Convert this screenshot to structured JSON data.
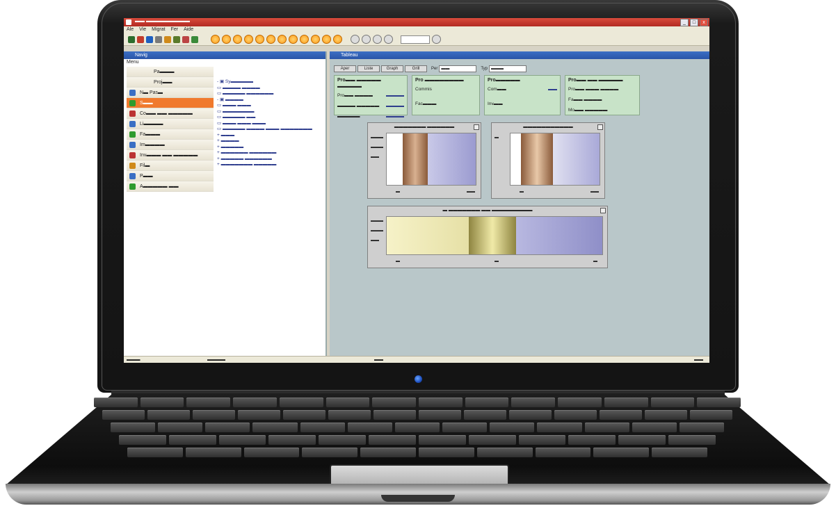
{
  "window": {
    "title": "▬▬ ▬▬▬▬▬▬▬▬▬",
    "controls": [
      "_",
      "□",
      "x"
    ]
  },
  "menu": [
    "Ale",
    "Vie",
    "Migrat",
    "Fer",
    "Aide"
  ],
  "toolbar": {
    "icon_colors": [
      "#2d6d2d",
      "#c23b2b",
      "#1f5fbf",
      "#7a7a7a",
      "#d08a1a",
      "#5a7a2a",
      "#b44",
      "#3a8a3a"
    ],
    "orange_buttons": 12,
    "gray_buttons": 4
  },
  "left_panel": {
    "title": "Navig",
    "section": "Menu",
    "nav_items": [
      {
        "label": "Pa▬▬▬",
        "icon": "none",
        "color": ""
      },
      {
        "label": "Proj▬▬",
        "icon": "none",
        "color": ""
      },
      {
        "label": "N▬ Pas▬",
        "icon": "user-icon",
        "color": "#3a6fc4"
      },
      {
        "label": "S▬▬",
        "icon": "folder-icon",
        "color": "#2e9b2e",
        "selected": true
      },
      {
        "label": "Co▬▬ ▬▬ ▬▬▬▬▬",
        "icon": "doc-icon",
        "color": "#b33"
      },
      {
        "label": "Li▬▬▬▬",
        "icon": "doc-icon",
        "color": "#3a6fc4"
      },
      {
        "label": "Fa▬▬▬",
        "icon": "doc-icon",
        "color": "#2e9b2e"
      },
      {
        "label": "Im▬▬▬▬",
        "icon": "doc-icon",
        "color": "#3a6fc4"
      },
      {
        "label": "Inv▬▬▬ ▬▬ ▬▬▬▬▬",
        "icon": "doc-icon",
        "color": "#b33"
      },
      {
        "label": "Fil▬",
        "icon": "doc-icon",
        "color": "#d08a1a"
      },
      {
        "label": "P▬▬",
        "icon": "doc-icon",
        "color": "#3a6fc4"
      },
      {
        "label": "A▬▬▬▬▬ ▬▬",
        "icon": "doc-icon",
        "color": "#2e9b2e"
      }
    ],
    "tree": [
      "- ▣ Sy▬▬▬▬▬",
      "   ▭ ▬▬▬▬ ▬▬▬▬",
      "   ▭ ▬▬▬▬▬ ▬▬▬▬▬▬",
      "- ▣ ▬▬▬▬",
      "   ▭ ▬▬▬ ▬▬▬",
      "   ▭ ▬▬▬▬▬▬▬",
      "   ▭ ▬▬▬▬▬ ▬▬",
      "   ▭ ▬▬▬ ▬▬▬ ▬▬▬",
      "   ▭ ▬▬▬▬▬ ▬▬▬▬ ▬▬▬ ▬▬▬▬▬▬▬",
      "+ ▬▬▬",
      "+ ▬▬▬▬",
      "+ ▬▬▬▬▬",
      "+ ▬▬▬▬▬▬ ▬▬▬▬▬▬",
      "+ ▬▬▬▬▬ ▬▬▬▬▬▬",
      "+ ▬▬▬▬▬▬▬ ▬▬▬▬▬"
    ]
  },
  "right_panel": {
    "title": "Tableau",
    "tabs": [
      "Aper",
      "Liste",
      "Graph",
      "Grill"
    ],
    "filter_label": "Per",
    "filter_value": "▬▬",
    "filter2_label": "Typ",
    "filter2_value": "▬▬▬",
    "cards": [
      {
        "title": "Pro▬▬ ▬▬▬▬▬ ▬▬▬▬▬",
        "lines": [
          [
            "Pro▬▬ ▬▬▬▬",
            "▬▬▬▬"
          ],
          [
            "▬▬▬▬ ▬▬▬▬▬",
            "▬▬▬▬"
          ],
          [
            "▬▬▬▬▬",
            "▬▬▬▬"
          ]
        ]
      },
      {
        "title": "Pro ▬▬▬▬▬▬▬▬",
        "lines": [
          [
            "Commis",
            ""
          ],
          [
            "",
            ""
          ],
          [
            "Fac▬▬▬",
            ""
          ]
        ]
      },
      {
        "title": "Pro▬▬▬▬▬",
        "lines": [
          [
            "Com▬▬",
            "▬▬"
          ],
          [
            "",
            ""
          ],
          [
            "Inv▬▬",
            ""
          ]
        ]
      },
      {
        "title": "Pro▬▬ ▬▬ ▬▬▬▬▬",
        "lines": [
          [
            "Pro▬▬ ▬▬▬ ▬▬▬▬",
            ""
          ],
          [
            "Fa▬▬ ▬▬▬▬",
            ""
          ],
          [
            "Mo▬▬ ▬▬▬▬▬",
            ""
          ]
        ]
      }
    ],
    "charts": [
      {
        "title": "▬▬▬▬▬▬▬ ▬▬▬▬▬▬",
        "ticks": [
          "▬▬▬",
          "▬▬▬",
          "▬▬"
        ],
        "xlabels": [
          "▬",
          "▬▬"
        ]
      },
      {
        "title": "▬▬▬▬▬▬▬▬▬▬▬",
        "ticks": [
          "▬"
        ],
        "xlabels": [
          "▬",
          "▬▬"
        ]
      },
      {
        "title": "▬ ▬▬▬▬▬▬▬ ▬▬ ▬▬▬▬▬▬▬▬▬",
        "ticks": [
          "▬▬▬",
          "▬▬▬",
          "▬▬"
        ],
        "xlabels": [
          "▬",
          "▬",
          "▬"
        ]
      }
    ]
  },
  "statusbar": [
    "▬▬▬",
    "▬▬▬▬",
    "▬▬",
    "▬▬"
  ]
}
